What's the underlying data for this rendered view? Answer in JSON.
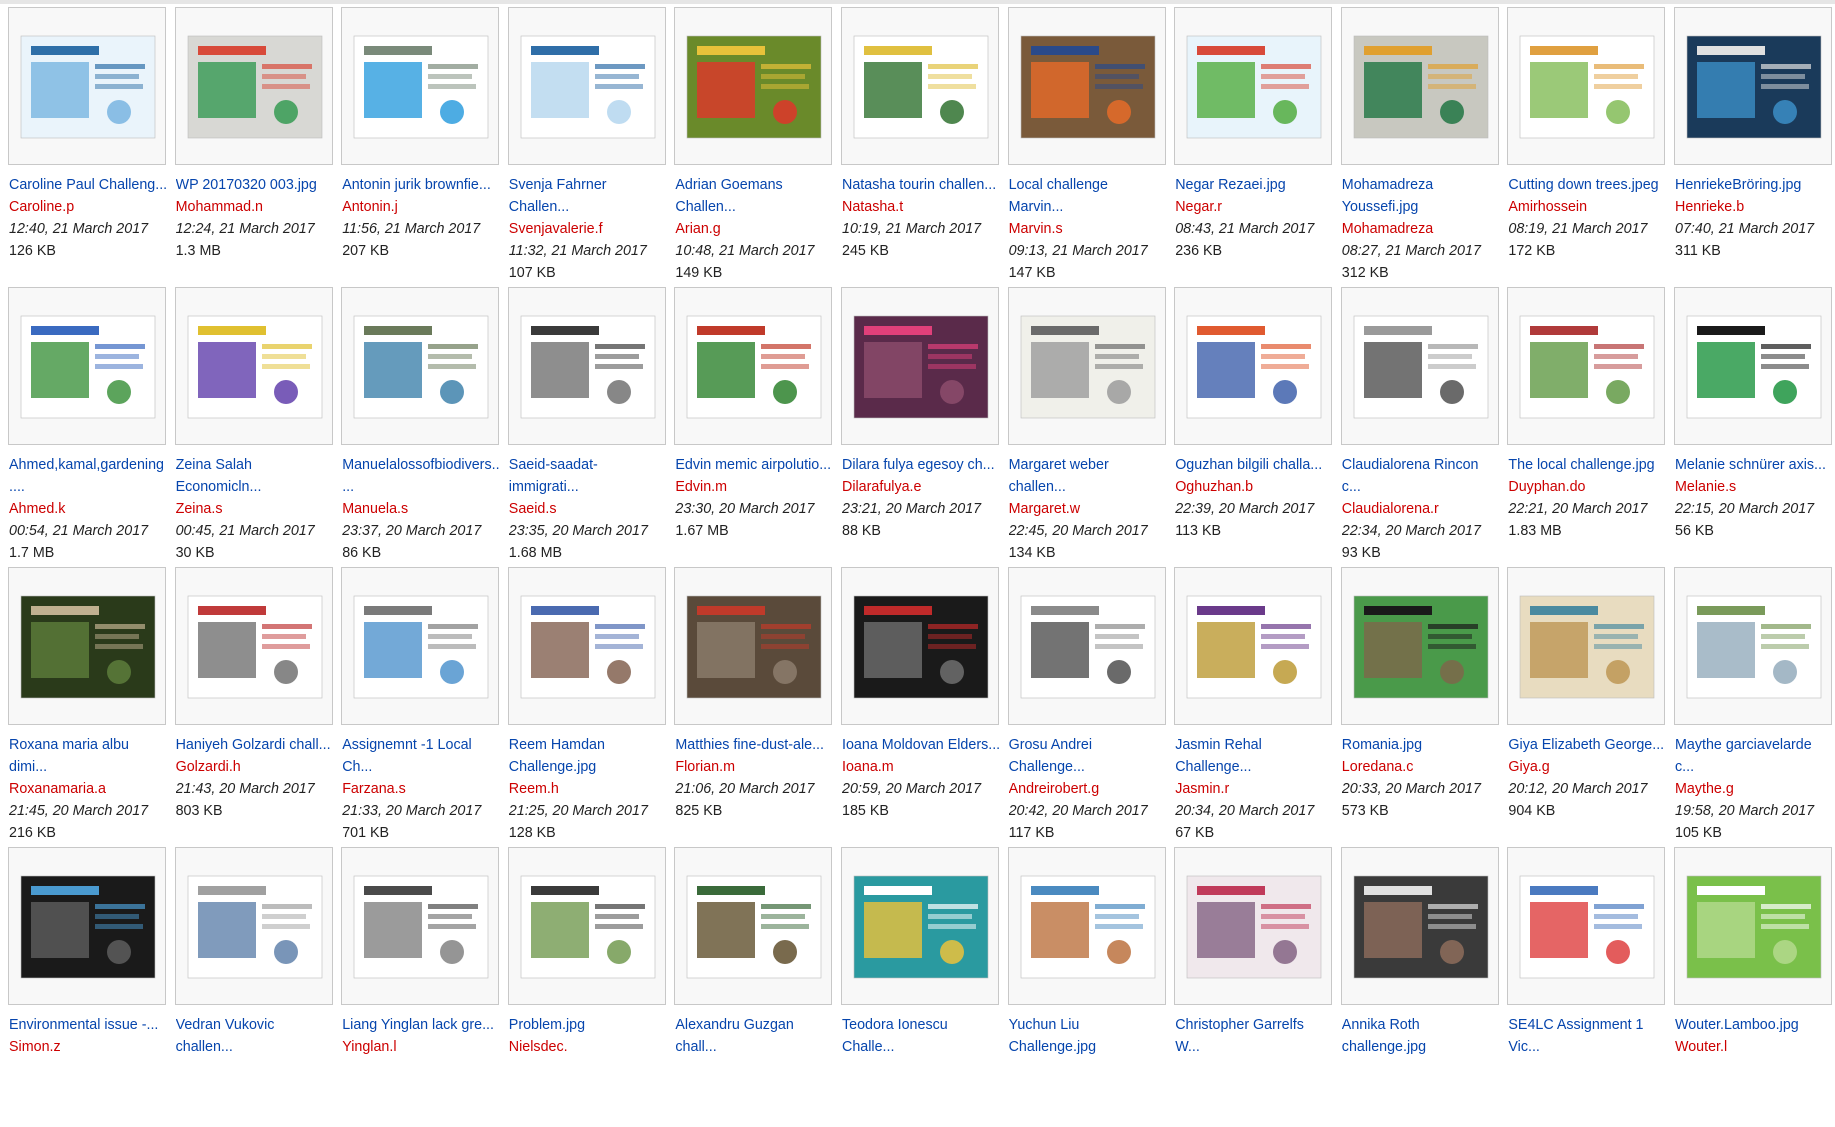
{
  "rows": [
    [
      {
        "name_lines": [
          "Caroline Paul Challeng..."
        ],
        "uploader": "Caroline.p",
        "date": "12:40, 21 March 2017",
        "size": "126 KB",
        "thumb": {
          "bg": "#eaf4fb",
          "main": "#7fb8e2",
          "accent": "#2e6fa8"
        }
      },
      {
        "name_lines": [
          "WP 20170320 003.jpg"
        ],
        "uploader": "Mohammad.n",
        "date": "12:24, 21 March 2017",
        "size": "1.3 MB",
        "thumb": {
          "bg": "#d8d8d4",
          "main": "#3f9e5a",
          "accent": "#d84a3a"
        }
      },
      {
        "name_lines": [
          "Antonin jurik brownfie..."
        ],
        "uploader": "Antonin.j",
        "date": "11:56, 21 March 2017",
        "size": "207 KB",
        "thumb": {
          "bg": "#ffffff",
          "main": "#3aa3e0",
          "accent": "#7a8a7a"
        }
      },
      {
        "name_lines": [
          "Svenja Fahrner",
          "Challen..."
        ],
        "uploader": "Svenjavalerie.f",
        "date": "11:32, 21 March 2017",
        "size": "107 KB",
        "thumb": {
          "bg": "#ffffff",
          "main": "#b8d8ef",
          "accent": "#2f6ea8"
        }
      },
      {
        "name_lines": [
          "Adrian Goemans",
          "Challen..."
        ],
        "uploader": "Arian.g",
        "date": "10:48, 21 March 2017",
        "size": "149 KB",
        "thumb": {
          "bg": "#6a8a2a",
          "main": "#d83a2a",
          "accent": "#e8c23a"
        }
      },
      {
        "name_lines": [
          "Natasha tourin challen..."
        ],
        "uploader": "Natasha.t",
        "date": "10:19, 21 March 2017",
        "size": "245 KB",
        "thumb": {
          "bg": "#ffffff",
          "main": "#3c7a3c",
          "accent": "#e0c040"
        }
      },
      {
        "name_lines": [
          "Local challenge",
          "Marvin..."
        ],
        "uploader": "Marvin.s",
        "date": "09:13, 21 March 2017",
        "size": "147 KB",
        "thumb": {
          "bg": "#7a5a3a",
          "main": "#e06a2a",
          "accent": "#2a4a8a"
        }
      },
      {
        "name_lines": [
          "Negar Rezaei.jpg"
        ],
        "uploader": "Negar.r",
        "date": "08:43, 21 March 2017",
        "size": "236 KB",
        "thumb": {
          "bg": "#e8f4fb",
          "main": "#5ab04a",
          "accent": "#d84a3a"
        }
      },
      {
        "name_lines": [
          "Mohamadreza",
          "Youssefi.jpg"
        ],
        "uploader": "Mohamadreza",
        "date": "08:27, 21 March 2017",
        "size": "312 KB",
        "thumb": {
          "bg": "#c8c8c0",
          "main": "#2a7a4a",
          "accent": "#e0a030"
        }
      },
      {
        "name_lines": [
          "Cutting down trees.jpeg"
        ],
        "uploader": "Amirhossein",
        "date": "08:19, 21 March 2017",
        "size": "172 KB",
        "thumb": {
          "bg": "#ffffff",
          "main": "#8ac060",
          "accent": "#e0a040"
        }
      },
      {
        "name_lines": [
          "HenriekeBröring.jpg"
        ],
        "uploader": "Henrieke.b",
        "date": "07:40, 21 March 2017",
        "size": "311 KB",
        "thumb": {
          "bg": "#1a3a5a",
          "main": "#3a8ac0",
          "accent": "#e0e0e0"
        }
      }
    ],
    [
      {
        "name_lines": [
          "Ahmed,kamal,gardening",
          "...."
        ],
        "uploader": "Ahmed.k",
        "date": "00:54, 21 March 2017",
        "size": "1.7 MB",
        "thumb": {
          "bg": "#ffffff",
          "main": "#4a9a4a",
          "accent": "#3a6ac0"
        }
      },
      {
        "name_lines": [
          "Zeina Salah",
          "Economicln..."
        ],
        "uploader": "Zeina.s",
        "date": "00:45, 21 March 2017",
        "size": "30 KB",
        "thumb": {
          "bg": "#ffffff",
          "main": "#6a4ab0",
          "accent": "#e0c030"
        }
      },
      {
        "name_lines": [
          "Manuelalossofbiodivers..",
          "..."
        ],
        "uploader": "Manuela.s",
        "date": "23:37, 20 March 2017",
        "size": "86 KB",
        "thumb": {
          "bg": "#ffffff",
          "main": "#4a8ab0",
          "accent": "#6a7a5a"
        }
      },
      {
        "name_lines": [
          "Saeid-saadat-",
          "immigrati..."
        ],
        "uploader": "Saeid.s",
        "date": "23:35, 20 March 2017",
        "size": "1.68 MB",
        "thumb": {
          "bg": "#ffffff",
          "main": "#7a7a7a",
          "accent": "#3a3a3a"
        }
      },
      {
        "name_lines": [
          "Edvin memic airpolutio..."
        ],
        "uploader": "Edvin.m",
        "date": "23:30, 20 March 2017",
        "size": "1.67 MB",
        "thumb": {
          "bg": "#ffffff",
          "main": "#3a8a3a",
          "accent": "#c03a2a"
        }
      },
      {
        "name_lines": [
          "Dilara fulya egesoy ch..."
        ],
        "uploader": "Dilarafulya.e",
        "date": "23:21, 20 March 2017",
        "size": "88 KB",
        "thumb": {
          "bg": "#5a2a4a",
          "main": "#8a4a6a",
          "accent": "#e0407a"
        }
      },
      {
        "name_lines": [
          "Margaret weber",
          "challen..."
        ],
        "uploader": "Margaret.w",
        "date": "22:45, 20 March 2017",
        "size": "134 KB",
        "thumb": {
          "bg": "#f0f0ea",
          "main": "#a0a0a0",
          "accent": "#6a6a6a"
        }
      },
      {
        "name_lines": [
          "Oguzhan bilgili challa..."
        ],
        "uploader": "Oghuzhan.b",
        "date": "22:39, 20 March 2017",
        "size": "113 KB",
        "thumb": {
          "bg": "#ffffff",
          "main": "#4a6ab0",
          "accent": "#e05a30"
        }
      },
      {
        "name_lines": [
          "Claudialorena Rincon",
          "c..."
        ],
        "uploader": "Claudialorena.r",
        "date": "22:34, 20 March 2017",
        "size": "93 KB",
        "thumb": {
          "bg": "#ffffff",
          "main": "#5a5a5a",
          "accent": "#9a9a9a"
        }
      },
      {
        "name_lines": [
          "The local challenge.jpg"
        ],
        "uploader": "Duyphan.do",
        "date": "22:21, 20 March 2017",
        "size": "1.83 MB",
        "thumb": {
          "bg": "#ffffff",
          "main": "#6aa050",
          "accent": "#b03a3a"
        }
      },
      {
        "name_lines": [
          "Melanie schnürer axis..."
        ],
        "uploader": "Melanie.s",
        "date": "22:15, 20 March 2017",
        "size": "56 KB",
        "thumb": {
          "bg": "#ffffff",
          "main": "#2a9a4a",
          "accent": "#1a1a1a"
        }
      }
    ],
    [
      {
        "name_lines": [
          "Roxana maria albu",
          "dimi..."
        ],
        "uploader": "Roxanamaria.a",
        "date": "21:45, 20 March 2017",
        "size": "216 KB",
        "thumb": {
          "bg": "#2a3a1a",
          "main": "#5a7a3a",
          "accent": "#c0b090"
        }
      },
      {
        "name_lines": [
          "Haniyeh Golzardi chall..."
        ],
        "uploader": "Golzardi.h",
        "date": "21:43, 20 March 2017",
        "size": "803 KB",
        "thumb": {
          "bg": "#ffffff",
          "main": "#7a7a7a",
          "accent": "#c03a3a"
        }
      },
      {
        "name_lines": [
          "Assignemnt -1 Local",
          "Ch..."
        ],
        "uploader": "Farzana.s",
        "date": "21:33, 20 March 2017",
        "size": "701 KB",
        "thumb": {
          "bg": "#ffffff",
          "main": "#5a9ad0",
          "accent": "#7a7a7a"
        }
      },
      {
        "name_lines": [
          "Reem Hamdan",
          "Challenge.jpg"
        ],
        "uploader": "Reem.h",
        "date": "21:25, 20 March 2017",
        "size": "128 KB",
        "thumb": {
          "bg": "#ffffff",
          "main": "#8a6a5a",
          "accent": "#4a6ab0"
        }
      },
      {
        "name_lines": [
          "Matthies fine-dust-ale..."
        ],
        "uploader": "Florian.m",
        "date": "21:06, 20 March 2017",
        "size": "825 KB",
        "thumb": {
          "bg": "#5a4a3a",
          "main": "#8a7a6a",
          "accent": "#c03a2a"
        }
      },
      {
        "name_lines": [
          "Ioana Moldovan Elders..."
        ],
        "uploader": "Ioana.m",
        "date": "20:59, 20 March 2017",
        "size": "185 KB",
        "thumb": {
          "bg": "#1a1a1a",
          "main": "#6a6a6a",
          "accent": "#c02a2a"
        }
      },
      {
        "name_lines": [
          "Grosu Andrei",
          "Challenge..."
        ],
        "uploader": "Andreirobert.g",
        "date": "20:42, 20 March 2017",
        "size": "117 KB",
        "thumb": {
          "bg": "#ffffff",
          "main": "#5a5a5a",
          "accent": "#8a8a8a"
        }
      },
      {
        "name_lines": [
          "Jasmin Rehal",
          "Challenge..."
        ],
        "uploader": "Jasmin.r",
        "date": "20:34, 20 March 2017",
        "size": "67 KB",
        "thumb": {
          "bg": "#ffffff",
          "main": "#c0a040",
          "accent": "#6a3a8a"
        }
      },
      {
        "name_lines": [
          "Romania.jpg"
        ],
        "uploader": "Loredana.c",
        "date": "20:33, 20 March 2017",
        "size": "573 KB",
        "thumb": {
          "bg": "#4a9a4a",
          "main": "#7a6a4a",
          "accent": "#1a1a1a"
        }
      },
      {
        "name_lines": [
          "Giya Elizabeth George..."
        ],
        "uploader": "Giya.g",
        "date": "20:12, 20 March 2017",
        "size": "904 KB",
        "thumb": {
          "bg": "#e8dcc0",
          "main": "#c09a5a",
          "accent": "#4a8aa0"
        }
      },
      {
        "name_lines": [
          "Maythe garciavelarde",
          "c..."
        ],
        "uploader": "Maythe.g",
        "date": "19:58, 20 March 2017",
        "size": "105 KB",
        "thumb": {
          "bg": "#ffffff",
          "main": "#9ab0c0",
          "accent": "#7a9a5a"
        }
      }
    ],
    [
      {
        "name_lines": [
          "Environmental issue -..."
        ],
        "uploader": "Simon.z",
        "date": "",
        "size": "",
        "thumb": {
          "bg": "#1a1a1a",
          "main": "#5a5a5a",
          "accent": "#4a9ad0"
        }
      },
      {
        "name_lines": [
          "Vedran Vukovic",
          "challen..."
        ],
        "uploader": "",
        "date": "",
        "size": "",
        "thumb": {
          "bg": "#ffffff",
          "main": "#6a8ab0",
          "accent": "#a0a0a0"
        }
      },
      {
        "name_lines": [
          "Liang Yinglan lack gre..."
        ],
        "uploader": "Yinglan.l",
        "date": "",
        "size": "",
        "thumb": {
          "bg": "#ffffff",
          "main": "#8a8a8a",
          "accent": "#4a4a4a"
        }
      },
      {
        "name_lines": [
          "Problem.jpg"
        ],
        "uploader": "Nielsdec.",
        "date": "",
        "size": "",
        "thumb": {
          "bg": "#ffffff",
          "main": "#7aa05a",
          "accent": "#3a3a3a"
        }
      },
      {
        "name_lines": [
          "Alexandru Guzgan",
          "chall..."
        ],
        "uploader": "",
        "date": "",
        "size": "",
        "thumb": {
          "bg": "#ffffff",
          "main": "#6a5a3a",
          "accent": "#3a6a3a"
        }
      },
      {
        "name_lines": [
          "Teodora Ionescu",
          "Challe..."
        ],
        "uploader": "",
        "date": "",
        "size": "",
        "thumb": {
          "bg": "#2a9aa0",
          "main": "#e0c040",
          "accent": "#ffffff"
        }
      },
      {
        "name_lines": [
          "Yuchun Liu",
          "Challenge.jpg"
        ],
        "uploader": "",
        "date": "",
        "size": "",
        "thumb": {
          "bg": "#ffffff",
          "main": "#c07a4a",
          "accent": "#4a8ac0"
        }
      },
      {
        "name_lines": [
          "Christopher Garrelfs",
          "W..."
        ],
        "uploader": "",
        "date": "",
        "size": "",
        "thumb": {
          "bg": "#f0e8ec",
          "main": "#8a6a8a",
          "accent": "#c03a5a"
        }
      },
      {
        "name_lines": [
          "Annika Roth",
          "challenge.jpg"
        ],
        "uploader": "",
        "date": "",
        "size": "",
        "thumb": {
          "bg": "#3a3a3a",
          "main": "#8a6a5a",
          "accent": "#e0e0e0"
        }
      },
      {
        "name_lines": [
          "SE4LC Assignment 1",
          "Vic..."
        ],
        "uploader": "",
        "date": "",
        "size": "",
        "thumb": {
          "bg": "#ffffff",
          "main": "#e04a4a",
          "accent": "#4a7ac0"
        }
      },
      {
        "name_lines": [
          "Wouter.Lamboo.jpg"
        ],
        "uploader": "Wouter.l",
        "date": "",
        "size": "",
        "thumb": {
          "bg": "#7ac04a",
          "main": "#b0d88a",
          "accent": "#ffffff"
        }
      }
    ]
  ]
}
